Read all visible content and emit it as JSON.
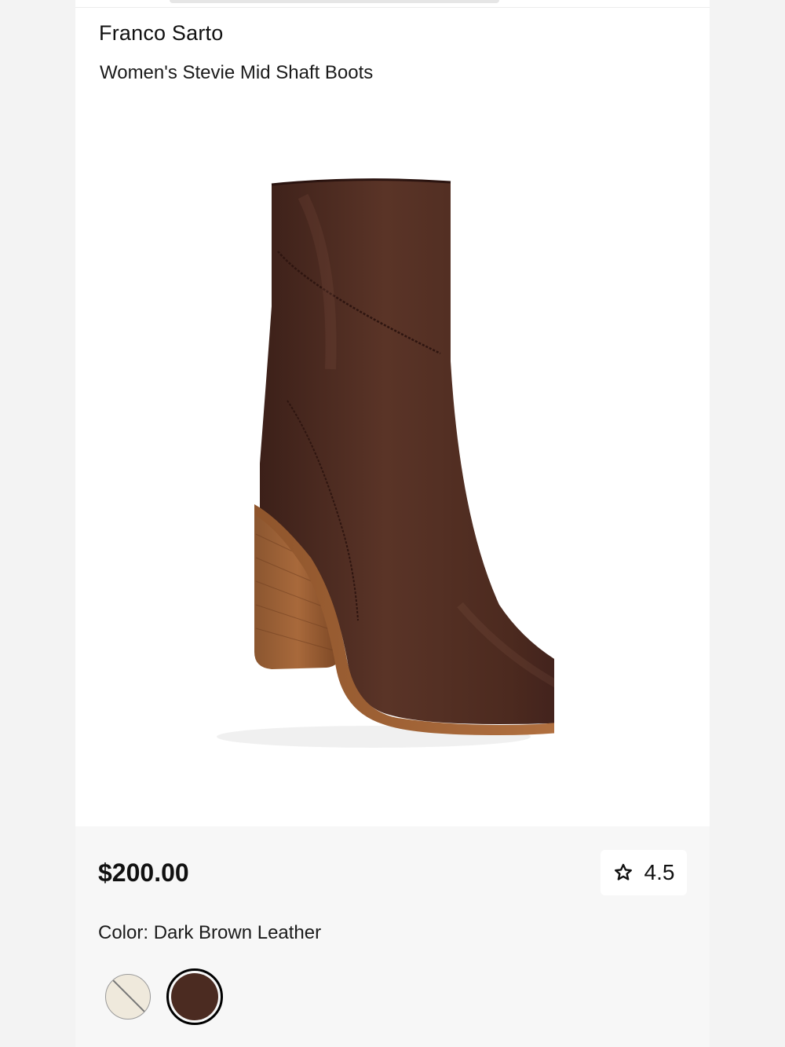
{
  "product": {
    "brand": "Franco Sarto",
    "name": "Women's Stevie Mid Shaft Boots",
    "price": "$200.00",
    "rating": "4.5",
    "color_label": "Color: Dark Brown Leather",
    "swatches": [
      {
        "name": "bone",
        "color": "#efe9dc",
        "selected": false,
        "unavailable": true
      },
      {
        "name": "dark-brown",
        "color": "#4b2b21",
        "selected": true,
        "unavailable": false
      }
    ]
  },
  "icons": {
    "rating": "star-outline-icon"
  },
  "colors": {
    "background": "#f7f7f7",
    "card": "#ffffff",
    "boot_leather": "#4a2a20",
    "boot_sole": "#9a5a2e"
  }
}
